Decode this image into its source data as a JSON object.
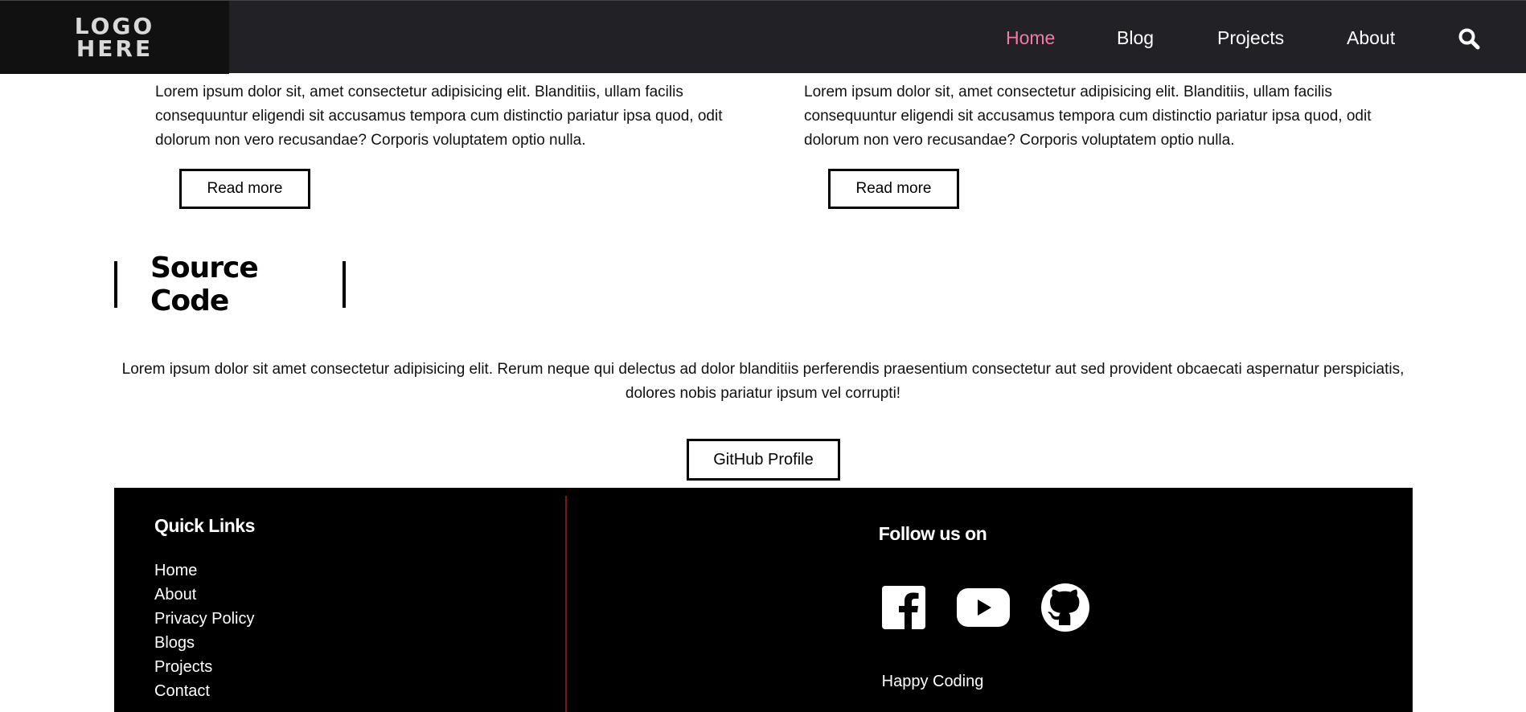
{
  "header": {
    "logo_line1": "LOGO",
    "logo_line2": "HERE",
    "nav": [
      {
        "label": "Home",
        "active": true
      },
      {
        "label": "Blog",
        "active": false
      },
      {
        "label": "Projects",
        "active": false
      },
      {
        "label": "About",
        "active": false
      }
    ],
    "search_icon": "search-icon",
    "accent_color": "#f27aa5"
  },
  "posts": [
    {
      "text": "Lorem ipsum dolor sit, amet consectetur adipisicing elit. Blanditiis, ullam facilis consequuntur eligendi sit accusamus tempora cum distinctio pariatur ipsa quod, odit dolorum non vero recusandae? Corporis voluptatem optio nulla.",
      "button": "Read more"
    },
    {
      "text": "Lorem ipsum dolor sit, amet consectetur adipisicing elit. Blanditiis, ullam facilis consequuntur eligendi sit accusamus tempora cum distinctio pariatur ipsa quod, odit dolorum non vero recusandae? Corporis voluptatem optio nulla.",
      "button": "Read more"
    }
  ],
  "source_code": {
    "title": "Source Code",
    "description": "Lorem ipsum dolor sit amet consectetur adipisicing elit. Rerum neque qui delectus ad dolor blanditiis perferendis praesentium consectetur aut sed provident obcaecati aspernatur perspiciatis, dolores nobis pariatur ipsum vel corrupti!",
    "button": "GitHub Profile"
  },
  "footer": {
    "quick_links_title": "Quick Links",
    "quick_links": [
      "Home",
      "About",
      "Privacy Policy",
      "Blogs",
      "Projects",
      "Contact"
    ],
    "follow_title": "Follow us on",
    "social_icons": [
      "facebook-icon",
      "youtube-icon",
      "github-icon"
    ],
    "tagline": "Happy Coding",
    "divider_color": "#8b1010"
  }
}
